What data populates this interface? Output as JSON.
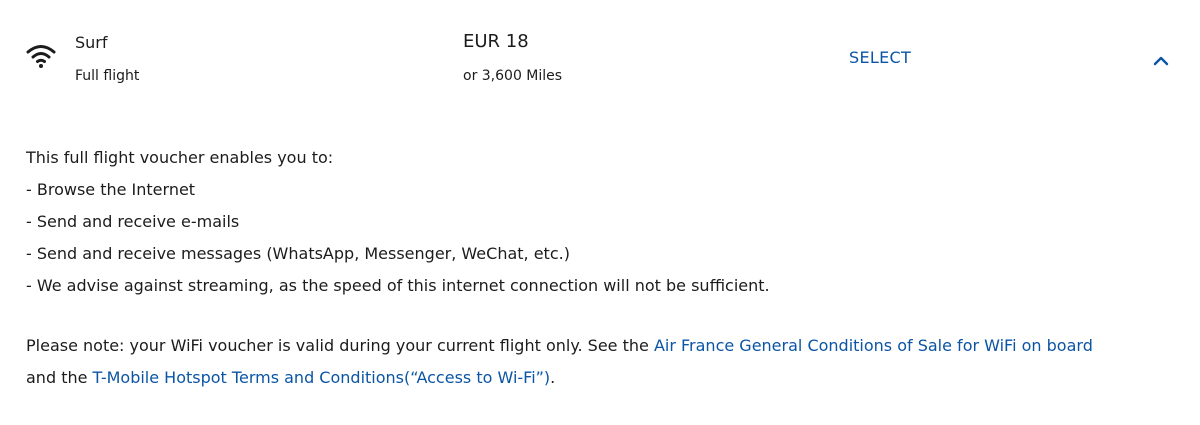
{
  "offer": {
    "icon": "wifi-icon",
    "name": "Surf",
    "subtitle": "Full flight",
    "price": "EUR 18",
    "miles": "or 3,600 Miles",
    "select_label": "SELECT",
    "toggle_icon": "chevron-up-icon"
  },
  "description": {
    "intro": "This full flight voucher enables you to:",
    "items": [
      "- Browse the Internet",
      "- Send and receive e-mails",
      "- Send and receive messages (WhatsApp, Messenger, WeChat, etc.)",
      "- We advise against streaming, as the speed of this internet connection will not be sufficient."
    ]
  },
  "note": {
    "prefix": "Please note: your WiFi voucher is valid during your current flight only. See the ",
    "link1": "Air France General Conditions of Sale for WiFi on board",
    "middle": "and the ",
    "link2": "T-Mobile Hotspot Terms and Conditions(“Access to Wi-Fi”)",
    "suffix": "."
  },
  "colors": {
    "link": "#0b55a5",
    "text": "#1c1c1c",
    "background": "#ffffff"
  }
}
